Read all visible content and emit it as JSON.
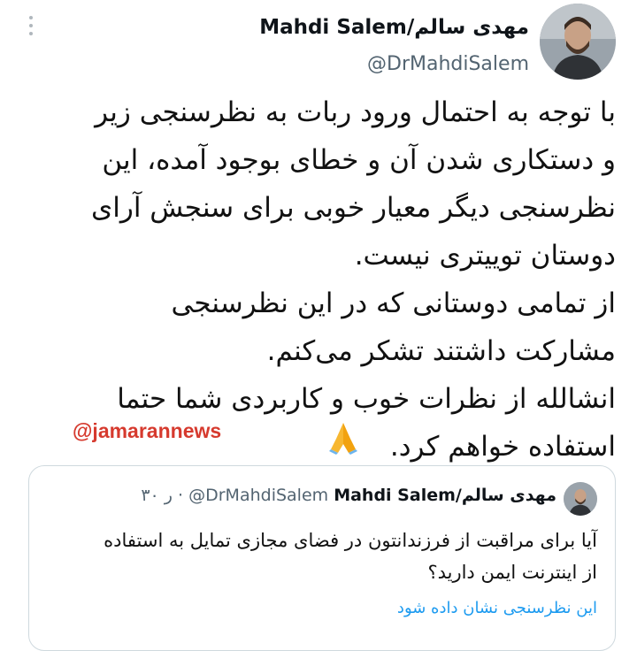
{
  "tweet": {
    "author_name": "Mahdi Salem/مهدی سالم",
    "author_handle": "@DrMahdiSalem",
    "lines": [
      "با توجه به احتمال ورود ربات به نظرسنجی زیر",
      "و دستکاری شدن آن و خطای بوجود آمده، این",
      "نظرسنجی دیگر معیار خوبی برای سنجش آرای",
      "دوستان توییتری نیست.",
      "از تمامی دوستانی که در این نظرسنجی",
      "مشارکت داشتند تشکر می‌کنم.",
      "انشالله از نظرات خوب و کاربردی شما حتما",
      "استفاده خواهم کرد."
    ],
    "emoji_icon": "folded-hands-emoji"
  },
  "watermark": "@jamarannews",
  "quoted": {
    "author_name": "Mahdi Salem/مهدی سالم",
    "author_handle": "@DrMahdiSalem",
    "time": "۳۰ ر",
    "separator": "·",
    "lines": [
      "آیا برای مراقبت از فرزندانتون در فضای مجازی تمایل به استفاده",
      "از اینترنت ایمن دارید؟"
    ],
    "poll_link": "این نظرسنجی نشان داده شود"
  },
  "colors": {
    "watermark": "#d63a2e",
    "link": "#1d9bf0",
    "secondary_text": "#536471"
  }
}
